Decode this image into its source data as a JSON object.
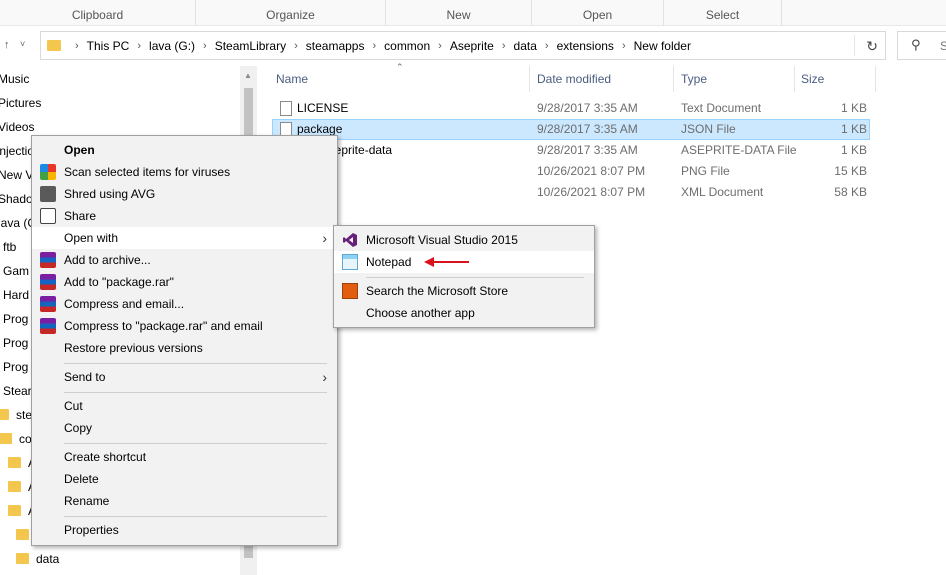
{
  "ribbon": {
    "groups": [
      "Clipboard",
      "Organize",
      "New",
      "Open",
      "Select"
    ]
  },
  "address": {
    "crumbs": [
      "This PC",
      "lava (G:)",
      "SteamLibrary",
      "steamapps",
      "common",
      "Aseprite",
      "data",
      "extensions",
      "New folder"
    ],
    "search_placeholder": "S"
  },
  "nav": {
    "items": [
      "Music",
      "Pictures",
      "Videos",
      "Injectio",
      "New V",
      "Shado",
      "lava (G",
      "ftb",
      "Gam",
      "Hard",
      "Prog",
      "Prog",
      "Prog",
      "Stear",
      "stea",
      "co",
      "A",
      "A",
      "A",
      "A",
      "data"
    ]
  },
  "files": {
    "headers": {
      "name": "Name",
      "date": "Date modified",
      "type": "Type",
      "size": "Size"
    },
    "rows": [
      {
        "name": "LICENSE",
        "date": "9/28/2017 3:35 AM",
        "type": "Text Document",
        "size": "1 KB"
      },
      {
        "name": "package",
        "date": "9/28/2017 3:35 AM",
        "type": "JSON File",
        "size": "1 KB"
      },
      {
        "name": "aseprite-data",
        "date": "9/28/2017 3:35 AM",
        "type": "ASEPRITE-DATA File",
        "size": "1 KB"
      },
      {
        "name": "",
        "date": "10/26/2021 8:07 PM",
        "type": "PNG File",
        "size": "15 KB"
      },
      {
        "name": "",
        "date": "10/26/2021 8:07 PM",
        "type": "XML Document",
        "size": "58 KB"
      }
    ]
  },
  "context_menu": {
    "open": "Open",
    "scan": "Scan selected items for viruses",
    "shred": "Shred using AVG",
    "share": "Share",
    "open_with": "Open with",
    "add_archive": "Add to archive...",
    "add_rar": "Add to \"package.rar\"",
    "compress_email": "Compress and email...",
    "compress_rar_email": "Compress to \"package.rar\" and email",
    "restore": "Restore previous versions",
    "send_to": "Send to",
    "cut": "Cut",
    "copy": "Copy",
    "create_shortcut": "Create shortcut",
    "delete": "Delete",
    "rename": "Rename",
    "properties": "Properties"
  },
  "open_with_menu": {
    "vs": "Microsoft Visual Studio 2015",
    "notepad": "Notepad",
    "store": "Search the Microsoft Store",
    "choose": "Choose another app"
  },
  "colors": {
    "selection": "#cce8ff",
    "annotation_arrow": "#d9121b",
    "folder": "#f3c64d"
  }
}
